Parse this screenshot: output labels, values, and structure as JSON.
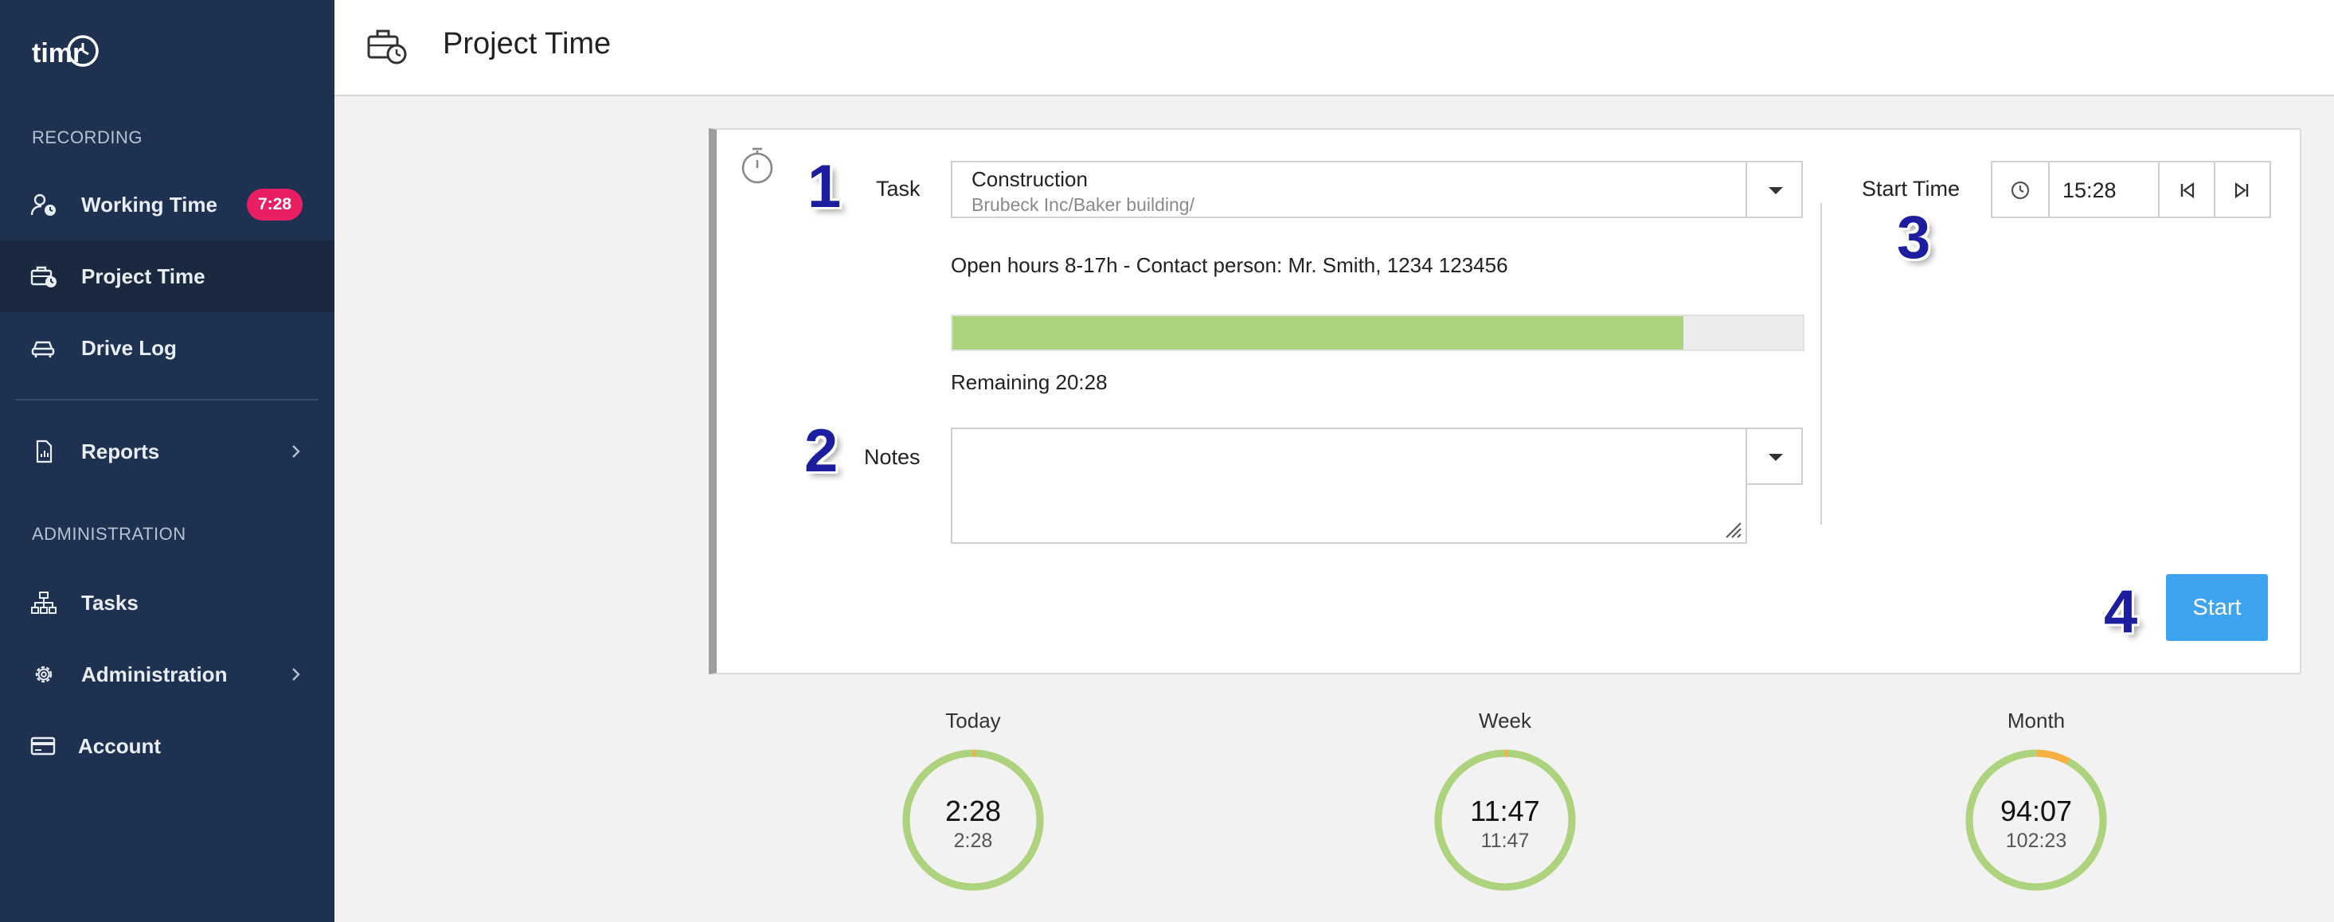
{
  "app": {
    "logo_text": "timr"
  },
  "sidebar": {
    "section_recording": "RECORDING",
    "section_administration": "ADMINISTRATION",
    "items": [
      {
        "label": "Working Time",
        "badge": "7:28"
      },
      {
        "label": "Project Time"
      },
      {
        "label": "Drive Log"
      },
      {
        "label": "Reports"
      },
      {
        "label": "Tasks"
      },
      {
        "label": "Administration"
      },
      {
        "label": "Account"
      }
    ]
  },
  "header": {
    "title": "Project Time"
  },
  "form": {
    "task_label": "Task",
    "task_name": "Construction",
    "task_path": "Brubeck Inc/Baker building/",
    "task_info": "Open hours 8-17h - Contact person: Mr. Smith, 1234 123456",
    "progress_fraction": 0.86,
    "remaining": "Remaining 20:28",
    "notes_label": "Notes",
    "notes_value": "",
    "start_time_label": "Start Time",
    "start_time_value": "15:28",
    "start_button": "Start"
  },
  "annotations": {
    "n1": "1",
    "n2": "2",
    "n3": "3",
    "n4": "4"
  },
  "summary": [
    {
      "label": "Today",
      "value": "2:28",
      "target": "2:28",
      "fraction": 1.0
    },
    {
      "label": "Week",
      "value": "11:47",
      "target": "11:47",
      "fraction": 1.0
    },
    {
      "label": "Month",
      "value": "94:07",
      "target": "102:23",
      "fraction": 0.92
    }
  ],
  "colors": {
    "sidebar_bg": "#1f3150",
    "badge": "#e91e63",
    "progress": "#acd47e",
    "ring_done": "#acd47e",
    "ring_remaining": "#f5b041",
    "primary": "#3ea3f0"
  }
}
